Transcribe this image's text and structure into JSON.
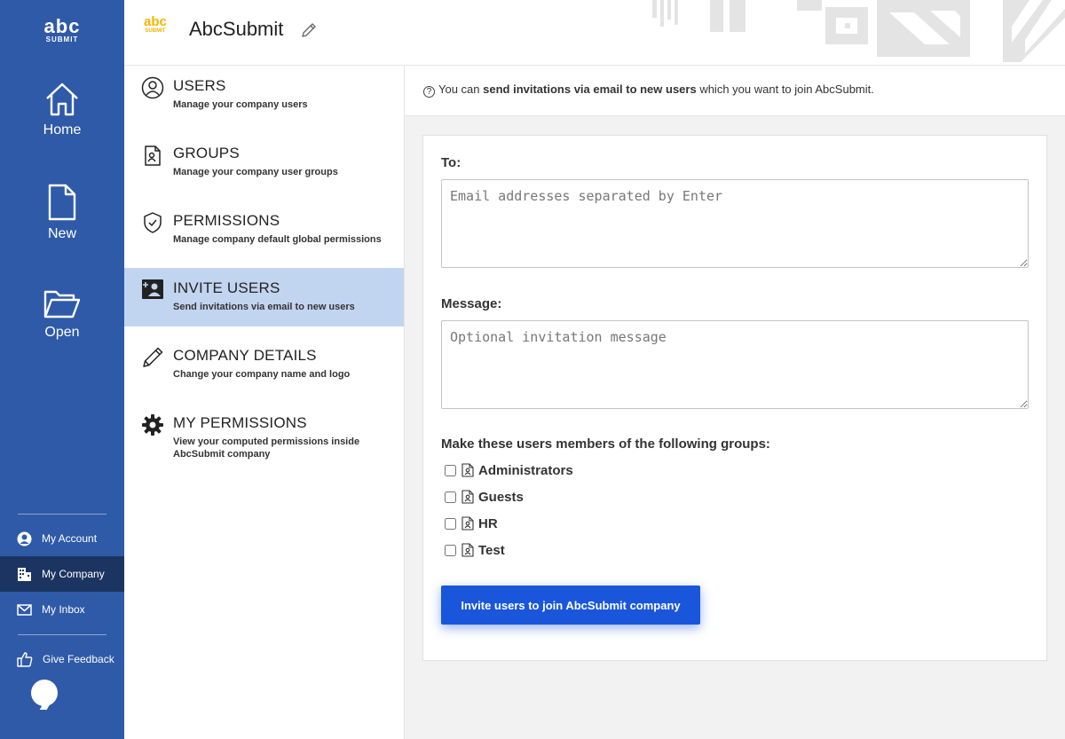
{
  "rail": {
    "logo_text": "abc",
    "logo_sub": "SUBMIT",
    "home_label": "Home",
    "new_label": "New",
    "open_label": "Open",
    "links": [
      {
        "label": "My Account",
        "icon": "account-circle-icon"
      },
      {
        "label": "My Company",
        "icon": "building-icon",
        "active": true
      },
      {
        "label": "My Inbox",
        "icon": "envelope-icon"
      }
    ],
    "feedback_label": "Give Feedback"
  },
  "header": {
    "logo_text": "abc",
    "logo_sub": "SUBMIT",
    "company_name": "AbcSubmit"
  },
  "menu": {
    "items": [
      {
        "title": "USERS",
        "desc": "Manage your company users",
        "icon": "user-circle-icon"
      },
      {
        "title": "GROUPS",
        "desc": "Manage your company user groups",
        "icon": "group-icon"
      },
      {
        "title": "PERMISSIONS",
        "desc": "Manage company default global permissions",
        "icon": "shield-check-icon"
      },
      {
        "title": "INVITE USERS",
        "desc": "Send invitations via email to new users",
        "icon": "invite-user-icon",
        "active": true
      },
      {
        "title": "COMPANY DETAILS",
        "desc": "Change your company name and logo",
        "icon": "pencil-icon"
      },
      {
        "title": "MY PERMISSIONS",
        "desc": "View your computed permissions inside AbcSubmit company",
        "icon": "gear-icon"
      }
    ]
  },
  "info": {
    "prefix": "You can ",
    "bold": "send invitations via email to new users",
    "suffix": " which you want to join AbcSubmit."
  },
  "form": {
    "to_label": "To:",
    "to_placeholder": "Email addresses separated by Enter",
    "message_label": "Message:",
    "message_placeholder": "Optional invitation message",
    "groups_label": "Make these users members of the following groups:",
    "groups": [
      {
        "name": "Administrators",
        "checked": false
      },
      {
        "name": "Guests",
        "checked": false
      },
      {
        "name": "HR",
        "checked": false
      },
      {
        "name": "Test",
        "checked": false
      }
    ],
    "submit_label": "Invite users to join AbcSubmit company"
  },
  "colors": {
    "rail": "#2f5aa8",
    "rail_active": "#1c3461",
    "menu_active": "#c2d5f0",
    "primary_button": "#1a56db",
    "logo_accent": "#f5b400"
  }
}
